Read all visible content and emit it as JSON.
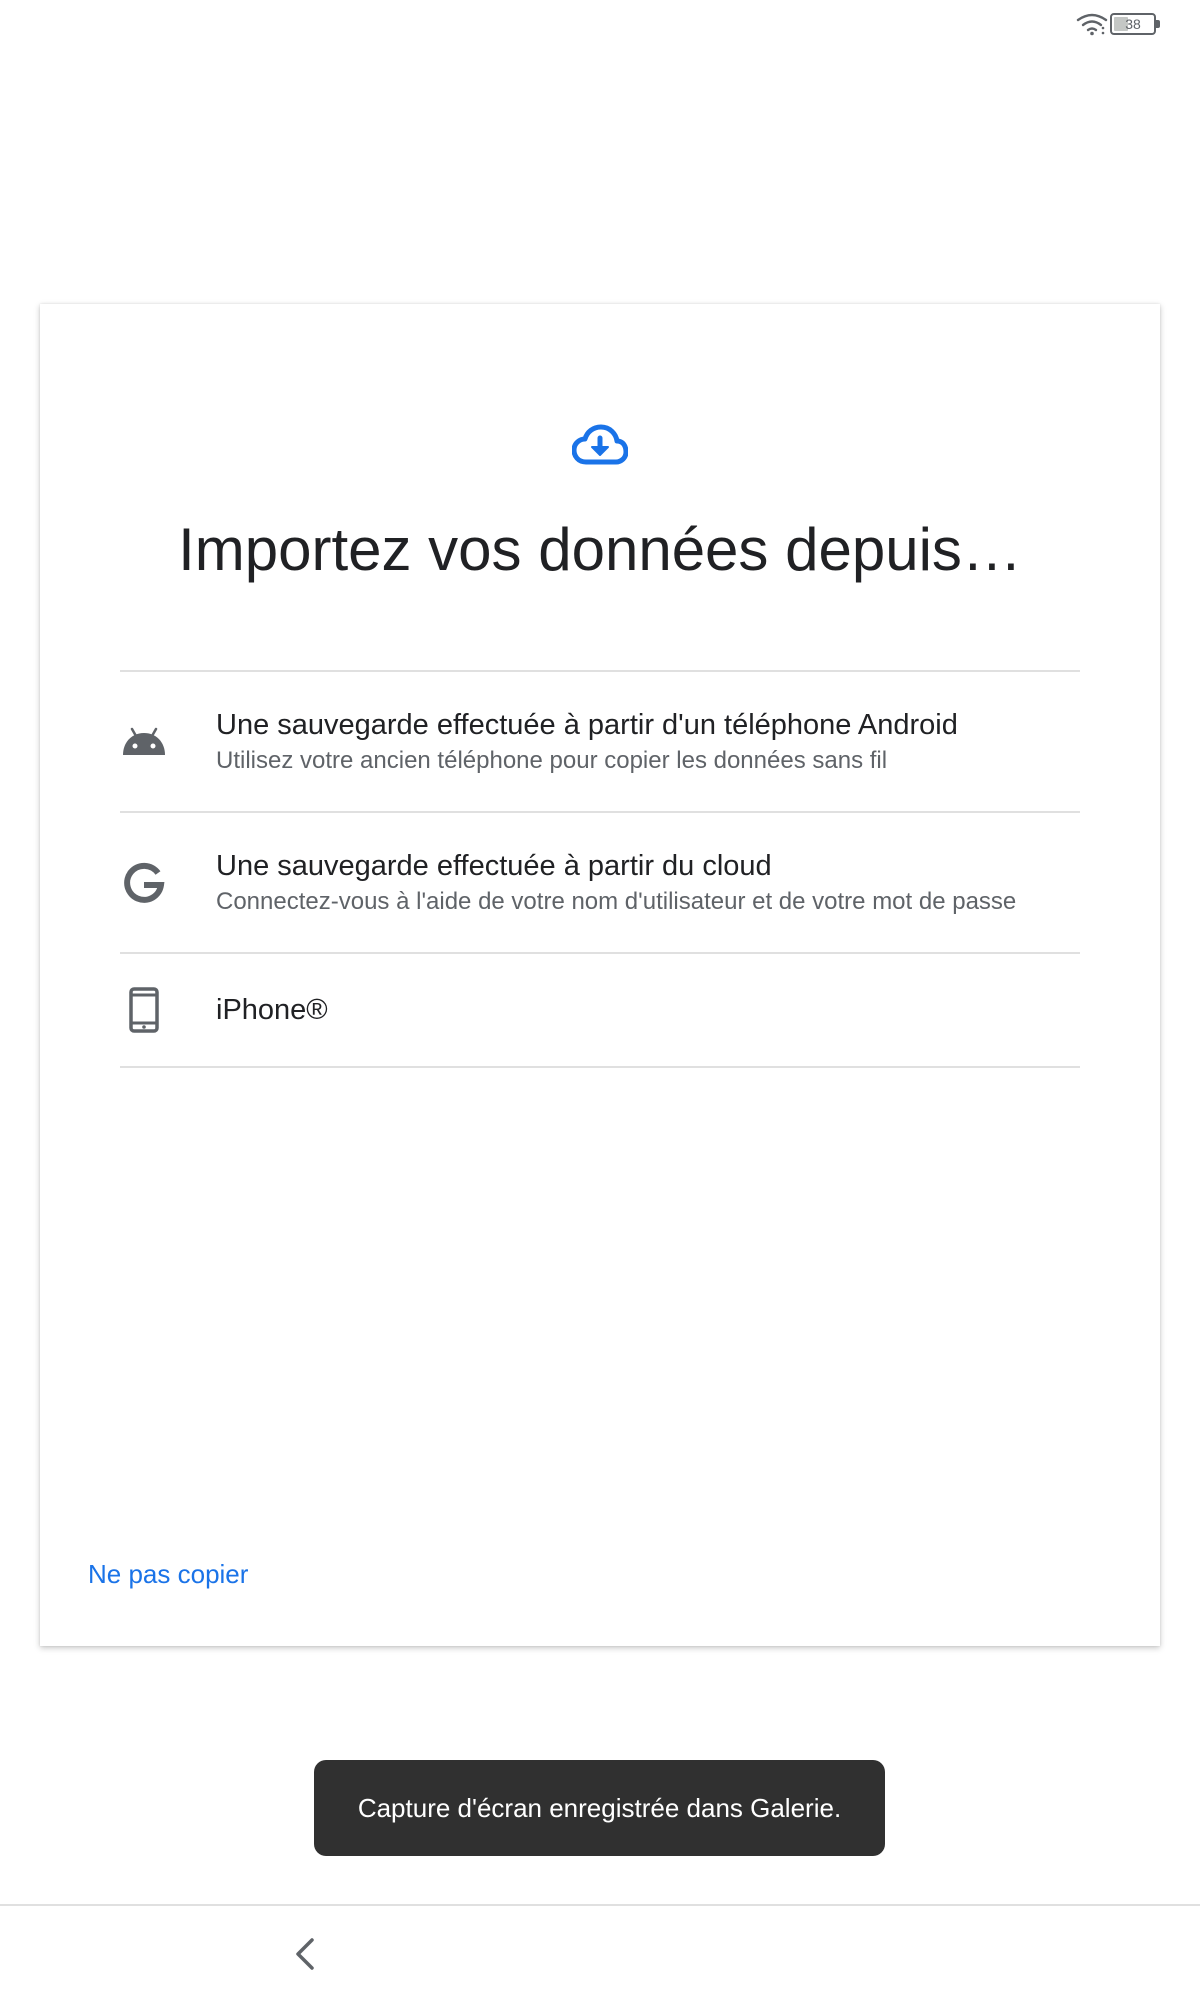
{
  "status_bar": {
    "battery_level": "38",
    "wifi_icon": "wifi-icon",
    "battery_icon": "battery-icon"
  },
  "card": {
    "header_icon": "cloud-download-icon",
    "accent_color": "#1a73e8",
    "title": "Importez vos données depuis…",
    "options": [
      {
        "icon": "android-icon",
        "title": "Une sauvegarde effectuée à partir d'un téléphone Android",
        "subtitle": "Utilisez votre ancien téléphone pour copier les données sans fil"
      },
      {
        "icon": "google-icon",
        "title": "Une sauvegarde effectuée à partir du cloud",
        "subtitle": "Connectez-vous à l'aide de votre nom d'utilisateur et de votre mot de passe"
      },
      {
        "icon": "phone-icon",
        "title": "iPhone®"
      }
    ],
    "skip_label": "Ne pas copier"
  },
  "toast": {
    "message": "Capture d'écran enregistrée dans Galerie."
  },
  "nav_bar": {
    "back_icon": "back-chevron-icon"
  }
}
